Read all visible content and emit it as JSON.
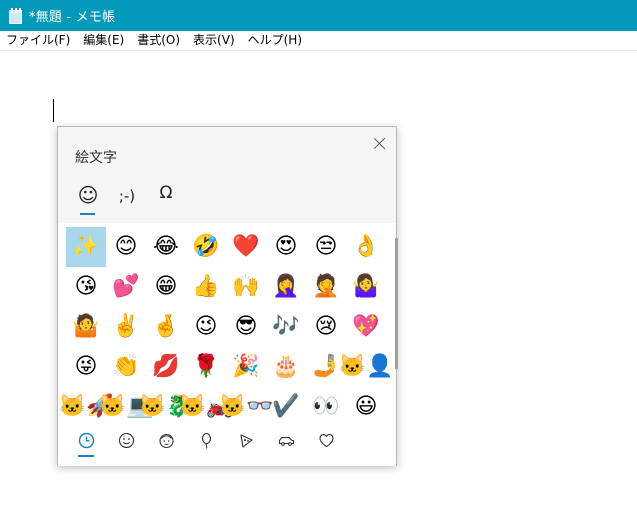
{
  "window": {
    "title": "*無題 - メモ帳"
  },
  "menu": [
    {
      "label": "ファイル(F)"
    },
    {
      "label": "編集(E)"
    },
    {
      "label": "書式(O)"
    },
    {
      "label": "表示(V)"
    },
    {
      "label": "ヘルプ(H)"
    }
  ],
  "picker": {
    "title": "絵文字",
    "category_tabs": [
      {
        "glyph": "☺",
        "icon": "emoji-icon"
      },
      {
        "glyph": ";-)",
        "icon": "kaomoji-icon"
      },
      {
        "glyph": "Ω",
        "icon": "symbols-icon"
      }
    ],
    "emojis": [
      "✨",
      "😊",
      "😂",
      "🤣",
      "❤️",
      "😍",
      "😒",
      "👌",
      "😘",
      "💕",
      "😁",
      "👍",
      "🙌",
      "🤦‍♀️",
      "🤦",
      "🤷‍♀️",
      "🤷",
      "✌️",
      "🤞",
      "😉",
      "😎",
      "🎶",
      "😢",
      "💖",
      "😜",
      "👏",
      "💋",
      "🌹",
      "🎉",
      "🎂",
      "🤳",
      "🐱‍👤",
      "🐱‍🚀",
      "🐱‍💻",
      "🐱‍🐉",
      "🐱‍🏍",
      "🐱‍👓",
      "✔️",
      "👀",
      "😃"
    ],
    "bottom_categories": [
      {
        "icon": "recent-clock-icon"
      },
      {
        "icon": "smiley-face-icon"
      },
      {
        "icon": "people-icon"
      },
      {
        "icon": "balloon-icon"
      },
      {
        "icon": "pizza-icon"
      },
      {
        "icon": "car-icon"
      },
      {
        "icon": "heart-icon"
      }
    ],
    "accent": "#1a83b8",
    "selected_color": "#a8d6ec"
  },
  "colors": {
    "titlebar": "#0399bb"
  }
}
